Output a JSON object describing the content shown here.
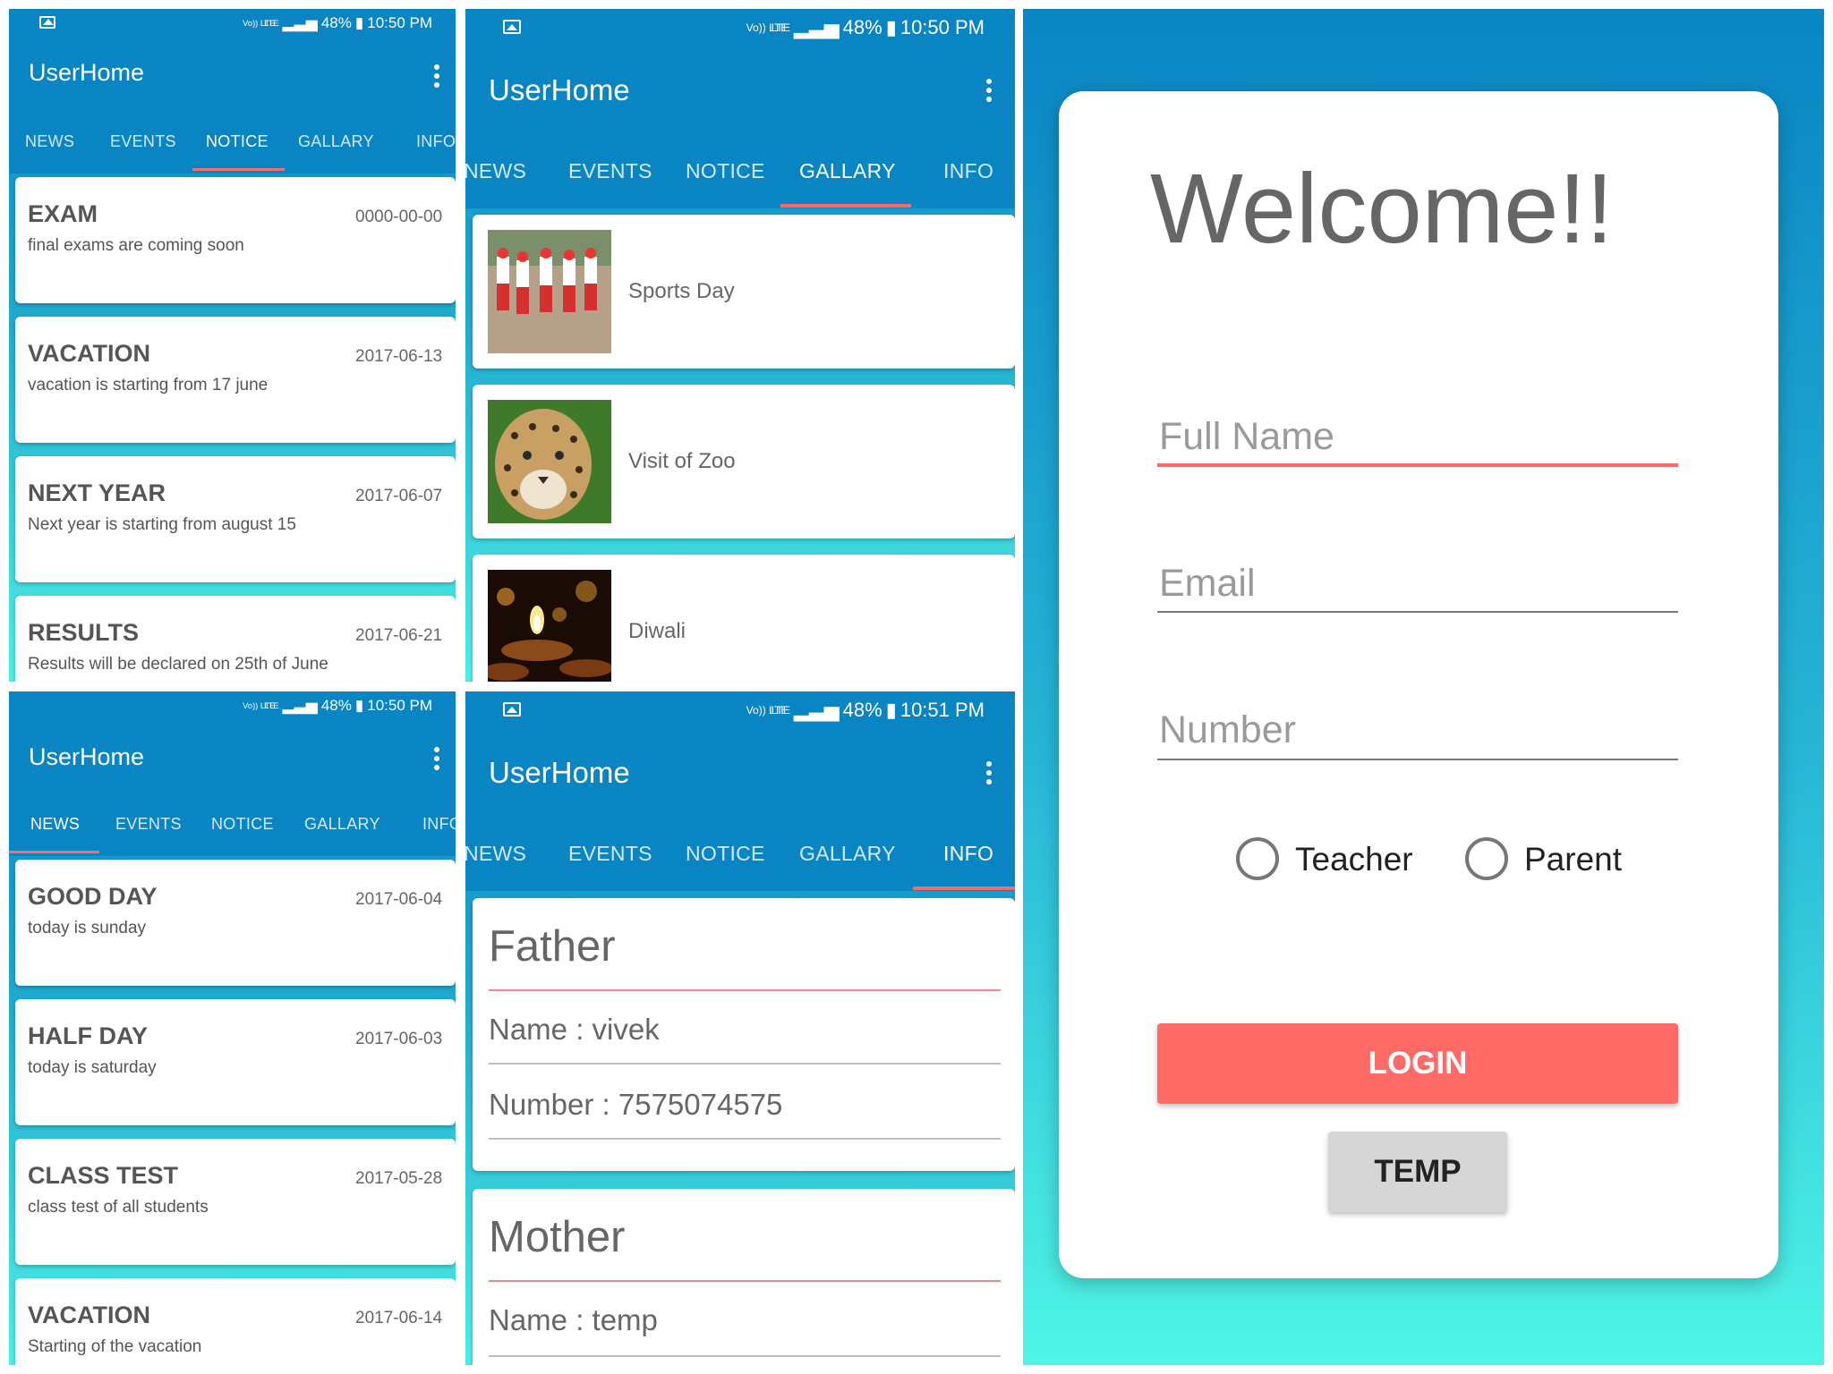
{
  "colors": {
    "toolbar": "#0a85c4",
    "accent": "#ff6a66",
    "background_top": "#0a85c4",
    "background_bottom": "#4defe4",
    "card": "#ffffff",
    "text": "#555555"
  },
  "status": {
    "volte": "Vo)) LTE",
    "lte": "LTE",
    "battery": "48%",
    "time_a": "10:50 PM",
    "time_b": "10:51 PM"
  },
  "app": {
    "title": "UserHome"
  },
  "tabs": [
    "NEWS",
    "EVENTS",
    "NOTICE",
    "GALLARY",
    "INFO"
  ],
  "tabs_clipped": {
    "news": "NEWS",
    "info": "INFO"
  },
  "notice": {
    "active_tab": "NOTICE",
    "items": [
      {
        "title": "EXAM",
        "date": "0000-00-00",
        "desc": "final exams are coming soon"
      },
      {
        "title": "VACATION",
        "date": "2017-06-13",
        "desc": "vacation is starting from 17 june"
      },
      {
        "title": "NEXT YEAR",
        "date": "2017-06-07",
        "desc": "Next year is starting from august 15"
      },
      {
        "title": "RESULTS",
        "date": "2017-06-21",
        "desc": "Results will be declared on 25th of June"
      }
    ]
  },
  "gallery": {
    "active_tab": "GALLARY",
    "items": [
      {
        "label": "Sports Day",
        "image": "sports-day-photo"
      },
      {
        "label": "Visit of Zoo",
        "image": "leopard-photo"
      },
      {
        "label": "Diwali",
        "image": "diya-lamps-photo"
      }
    ]
  },
  "news": {
    "active_tab": "NEWS",
    "items": [
      {
        "title": "GOOD DAY",
        "date": "2017-06-04",
        "desc": "today is sunday"
      },
      {
        "title": "HALF DAY",
        "date": "2017-06-03",
        "desc": "today is saturday"
      },
      {
        "title": "CLASS TEST",
        "date": "2017-05-28",
        "desc": "class test of all students"
      },
      {
        "title": "VACATION",
        "date": "2017-06-14",
        "desc": "Starting of the vacation"
      }
    ]
  },
  "info": {
    "active_tab": "INFO",
    "father": {
      "heading": "Father",
      "name": "Name : vivek",
      "number": "Number : 7575074575"
    },
    "mother": {
      "heading": "Mother",
      "name": "Name : temp"
    }
  },
  "login": {
    "welcome": "Welcome!!",
    "full_name_placeholder": "Full Name",
    "email_placeholder": "Email",
    "number_placeholder": "Number",
    "radio_teacher": "Teacher",
    "radio_parent": "Parent",
    "login_button": "LOGIN",
    "temp_button": "TEMP"
  }
}
